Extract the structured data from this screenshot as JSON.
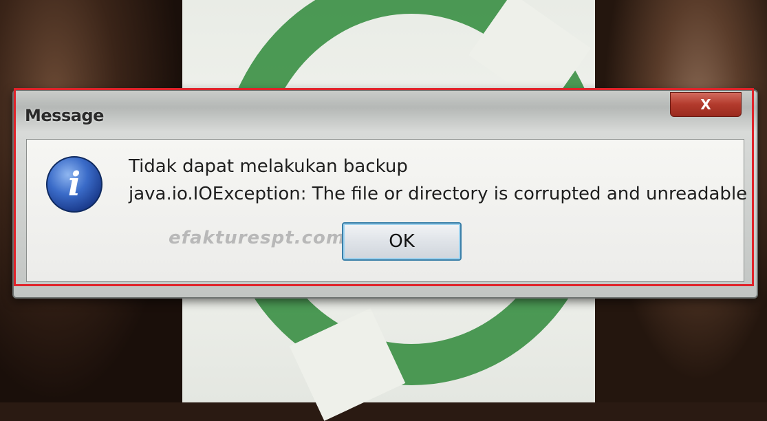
{
  "dialog": {
    "title": "Message",
    "close_label": "X",
    "message_line1": "Tidak dapat melakukan backup",
    "message_line2": "java.io.IOException: The file or directory is corrupted and unreadable",
    "ok_label": "OK",
    "icon": "info-icon"
  },
  "watermark": "efakturespt.com",
  "colors": {
    "highlight_frame": "#e0232a",
    "logo_green": "#2f8a3a",
    "info_icon_blue": "#3a6bc8",
    "close_button_red": "#b23a2c"
  }
}
